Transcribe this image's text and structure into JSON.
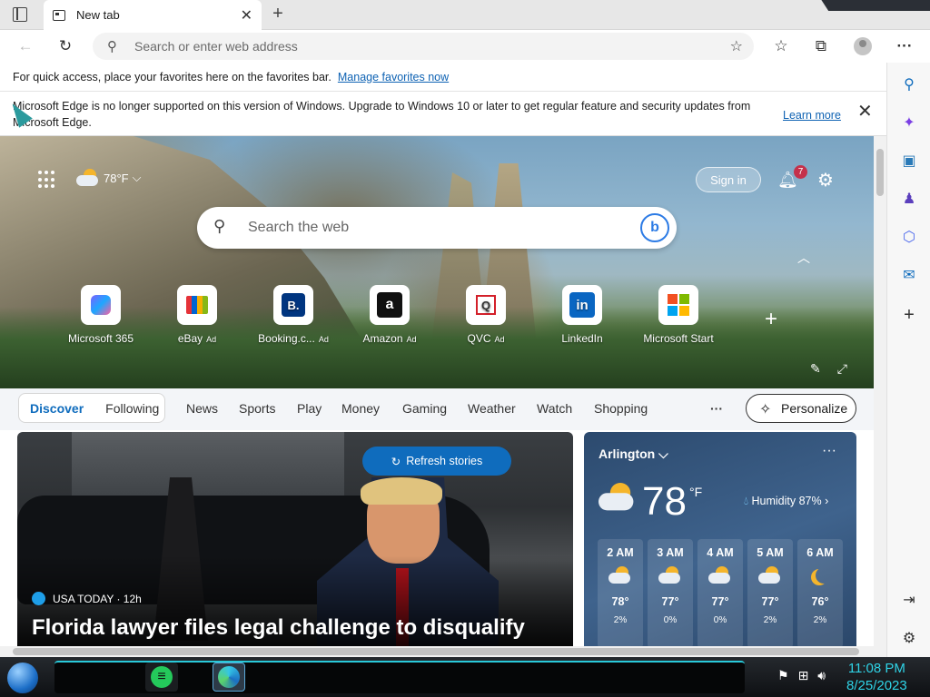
{
  "browser": {
    "tab_title": "New tab",
    "new_tab_symbol": "+",
    "address_placeholder": "Search or enter web address"
  },
  "favorites_bar": {
    "text": "For quick access, place your favorites here on the favorites bar.",
    "link": "Manage favorites now"
  },
  "info_bar": {
    "message": "Microsoft Edge is no longer supported on this version of Windows. Upgrade to Windows 10 or later to get regular feature and security updates from Microsoft Edge.",
    "link": "Learn more"
  },
  "hero": {
    "weather_temp": "78°F",
    "sign_in": "Sign in",
    "notifications_count": "7",
    "search_placeholder": "Search the web",
    "tiles": [
      {
        "label": "Microsoft 365",
        "ad": ""
      },
      {
        "label": "eBay",
        "ad": "Ad"
      },
      {
        "label": "Booking.c...",
        "ad": "Ad"
      },
      {
        "label": "Amazon",
        "ad": "Ad"
      },
      {
        "label": "QVC",
        "ad": "Ad"
      },
      {
        "label": "LinkedIn",
        "ad": ""
      },
      {
        "label": "Microsoft Start",
        "ad": ""
      }
    ]
  },
  "feed": {
    "discover": "Discover",
    "following": "Following",
    "nav": [
      "News",
      "Sports",
      "Play",
      "Money",
      "Gaming",
      "Weather",
      "Watch",
      "Shopping"
    ],
    "more": "···",
    "personalize": "Personalize"
  },
  "story": {
    "refresh": "Refresh stories",
    "source": "USA TODAY · 12h",
    "headline": "Florida lawyer files legal challenge to disqualify"
  },
  "weather_card": {
    "location": "Arlington",
    "temp": "78",
    "unit": "°F",
    "humidity": "Humidity 87%",
    "more": "···",
    "hours": [
      {
        "time": "2 AM",
        "temp": "78°",
        "precip": "2%",
        "icon": "cloud-moon"
      },
      {
        "time": "3 AM",
        "temp": "77°",
        "precip": "0%",
        "icon": "cloud-moon"
      },
      {
        "time": "4 AM",
        "temp": "77°",
        "precip": "0%",
        "icon": "cloud-moon"
      },
      {
        "time": "5 AM",
        "temp": "77°",
        "precip": "2%",
        "icon": "cloud-moon"
      },
      {
        "time": "6 AM",
        "temp": "76°",
        "precip": "2%",
        "icon": "moon"
      }
    ]
  },
  "taskbar": {
    "time": "11:08 PM",
    "date": "8/25/2023"
  },
  "colors": {
    "accent": "#0f6cbd",
    "link": "#0e62b3",
    "badge": "#c4314b",
    "clock": "#2fd3e6"
  }
}
